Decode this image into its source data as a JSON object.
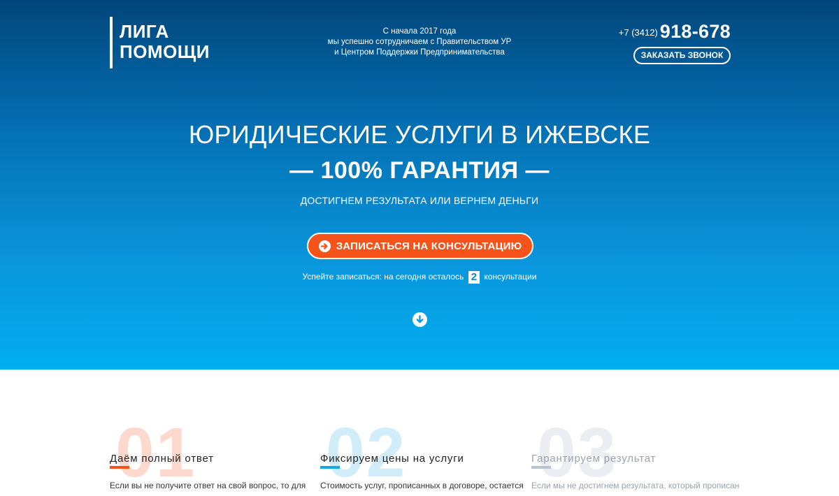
{
  "header": {
    "logo_line1": "ЛИГА",
    "logo_line2": "ПОМОЩИ",
    "notice_line1": "С начала 2017 года",
    "notice_line2": "мы успешно сотрудничаем с Правительством УР",
    "notice_line3": "и Центром Поддержки Предпринимательства",
    "phone_code": "+7 (3412)",
    "phone_number": "918-678",
    "callback_label": "ЗАКАЗАТЬ ЗВОНОК"
  },
  "hero": {
    "title": "ЮРИДИЧЕСКИЕ УСЛУГИ В ИЖЕВСКЕ",
    "guarantee": "— 100% ГАРАНТИЯ —",
    "subtitle": "ДОСТИГНЕМ РЕЗУЛЬТАТА ИЛИ ВЕРНЕМ ДЕНЬГИ",
    "cta_label": "ЗАПИСАТЬСЯ НА КОНСУЛЬТАЦИЮ",
    "cta_icon": "arrow-right-circle-icon",
    "hurry_before": "Успейте записаться: на сегодня осталось",
    "hurry_count": "2",
    "hurry_after": "консультации",
    "scroll_icon": "arrow-down-circle-icon"
  },
  "colors": {
    "accent_orange": "#f5531a",
    "accent_blue": "#17a6e6",
    "accent_gray": "#b8c4d0"
  },
  "features": [
    {
      "number": "01",
      "title": "Даём полный ответ",
      "text": "Если вы не получите ответ на свой вопрос, то для"
    },
    {
      "number": "02",
      "title": "Фиксируем цены на услуги",
      "text": "Стоимость услуг, прописанных в договоре, остается"
    },
    {
      "number": "03",
      "title": "Гарантируем результат",
      "text": "Если мы не достигнем результата, который прописан"
    }
  ]
}
